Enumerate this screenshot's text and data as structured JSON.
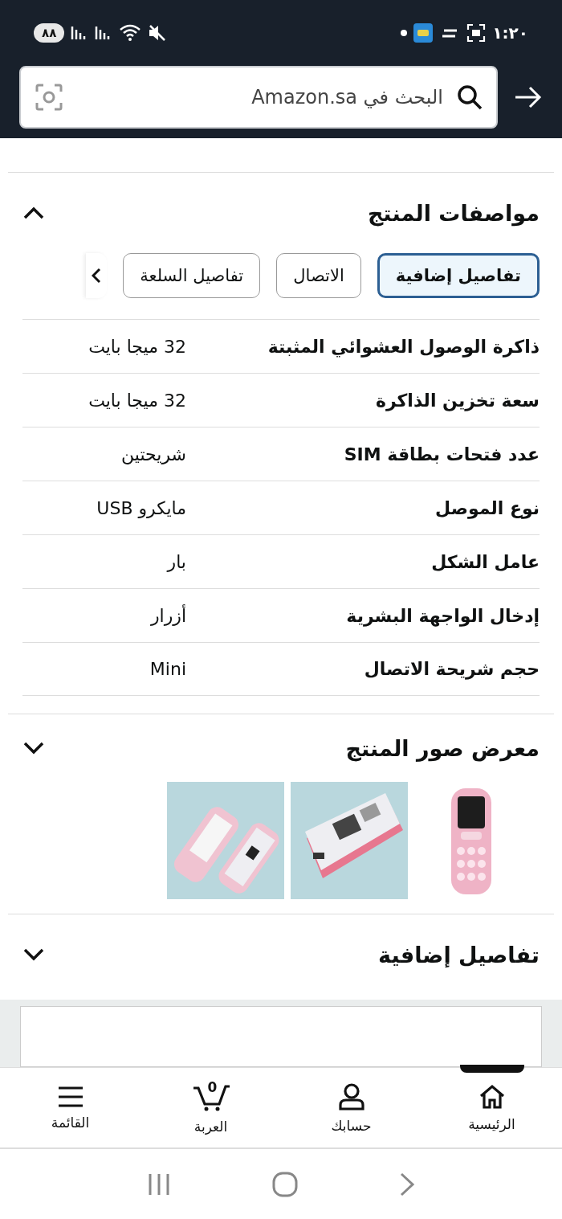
{
  "status_bar": {
    "time": "١:٢٠",
    "battery": "٨٨"
  },
  "search": {
    "placeholder": "البحث في Amazon.sa"
  },
  "specs_section": {
    "title": "مواصفات المنتج",
    "expanded": true,
    "tabs": [
      {
        "label": "تفاصيل إضافية",
        "selected": true
      },
      {
        "label": "الاتصال",
        "selected": false
      },
      {
        "label": "تفاصيل السلعة",
        "selected": false
      }
    ],
    "rows": [
      {
        "name": "ذاكرة الوصول العشوائي المثبتة",
        "value": "32 ميجا بايت"
      },
      {
        "name": "سعة تخزين الذاكرة",
        "value": "32 ميجا بايت"
      },
      {
        "name": "عدد فتحات بطاقة SIM",
        "value": "شريحتين"
      },
      {
        "name": "نوع الموصل",
        "value": "مايكرو USB"
      },
      {
        "name": "عامل الشكل",
        "value": "بار"
      },
      {
        "name": "إدخال الواجهة البشرية",
        "value": "أزرار"
      },
      {
        "name": "حجم شريحة الاتصال",
        "value": "Mini"
      }
    ]
  },
  "gallery_section": {
    "title": "معرض صور المنتج",
    "expanded": false
  },
  "details_section": {
    "title": "تفاصيل إضافية",
    "expanded": false
  },
  "bottom_nav": [
    {
      "kind": "home",
      "label": "الرئيسية",
      "selected": true
    },
    {
      "kind": "account",
      "label": "حسابك",
      "selected": false
    },
    {
      "kind": "cart",
      "label": "العربة",
      "count": "0",
      "selected": false
    },
    {
      "kind": "menu",
      "label": "القائمة",
      "selected": false
    }
  ]
}
